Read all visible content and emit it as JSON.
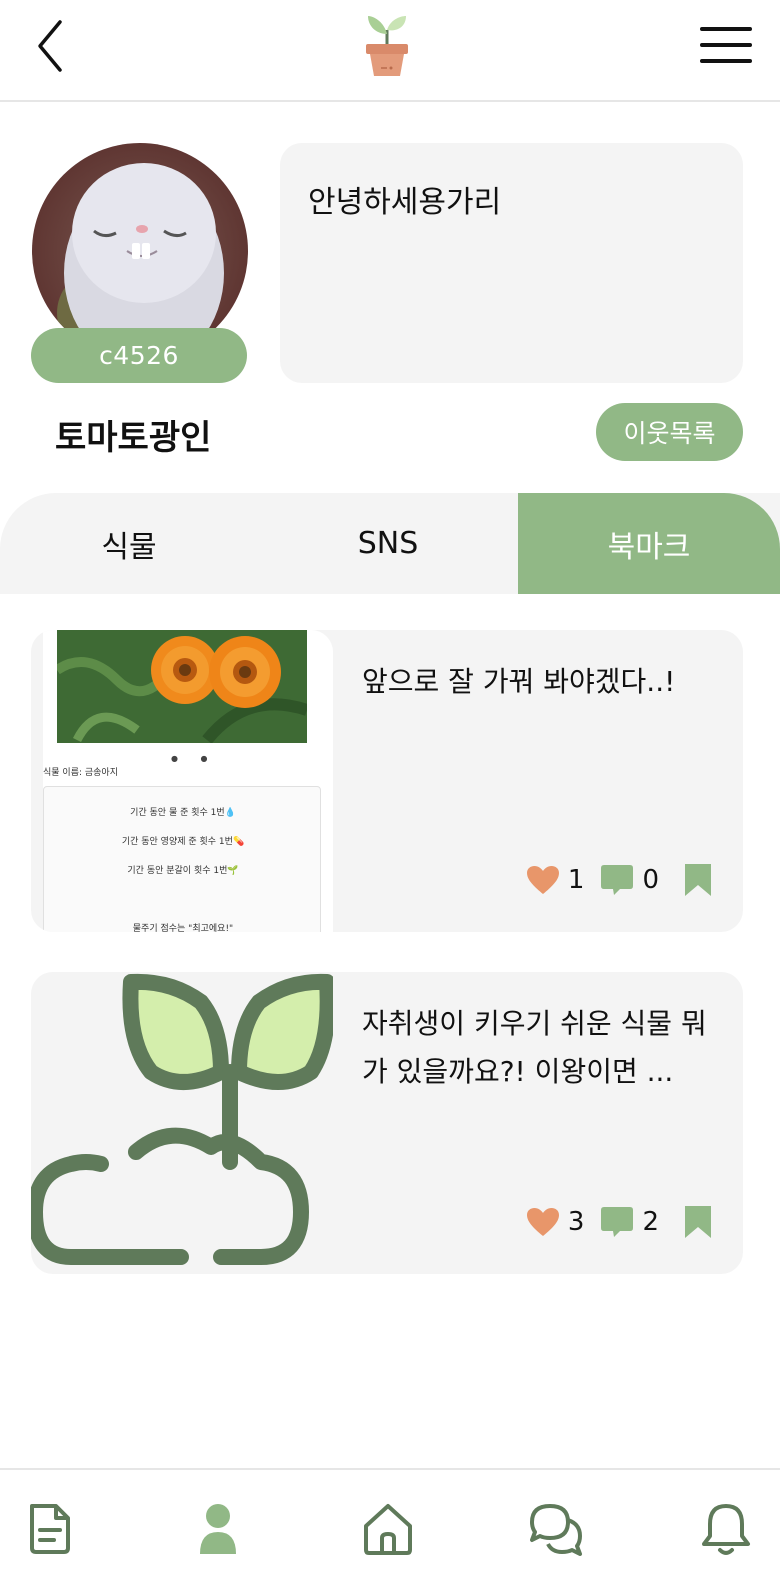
{
  "header": {
    "back_icon": "chevron-left-icon",
    "logo_icon": "sprout-pot-icon",
    "menu_icon": "hamburger-menu-icon"
  },
  "profile": {
    "user_id": "c4526",
    "intro": "안녕하세용가리",
    "nickname": "토마토광인",
    "neighbors_label": "이웃목록"
  },
  "tabs": [
    {
      "label": "식물",
      "active": false
    },
    {
      "label": "SNS",
      "active": false
    },
    {
      "label": "북마크",
      "active": true
    }
  ],
  "posts": [
    {
      "text": "앞으로 잘 가꿔 봐야겠다..!",
      "likes": "1",
      "comments": "0",
      "bookmarked": true,
      "thumb": {
        "plant_name": "식물 이름: 금송아지",
        "lines": [
          "기간 동안 물 준 횟수 1번💧",
          "기간 동안 영양제 준 횟수 1번💊",
          "기간 동안 분갈이 횟수 1번🌱"
        ],
        "footer": "물주기 점수는 \"최고에요!\""
      }
    },
    {
      "text": "자취생이 키우기 쉬운 식물 뭐가 있을까요?! 이왕이면 ...",
      "likes": "3",
      "comments": "2",
      "bookmarked": true
    }
  ],
  "bottom_nav": [
    {
      "icon": "document-icon",
      "active": false
    },
    {
      "icon": "profile-icon",
      "active": true
    },
    {
      "icon": "home-icon",
      "active": false
    },
    {
      "icon": "chat-icon",
      "active": false
    },
    {
      "icon": "bell-icon",
      "active": false
    }
  ],
  "colors": {
    "accent": "#91b886",
    "dark_green": "#5f7a5a",
    "heart": "#e8966a",
    "card_bg": "#f4f4f4"
  }
}
